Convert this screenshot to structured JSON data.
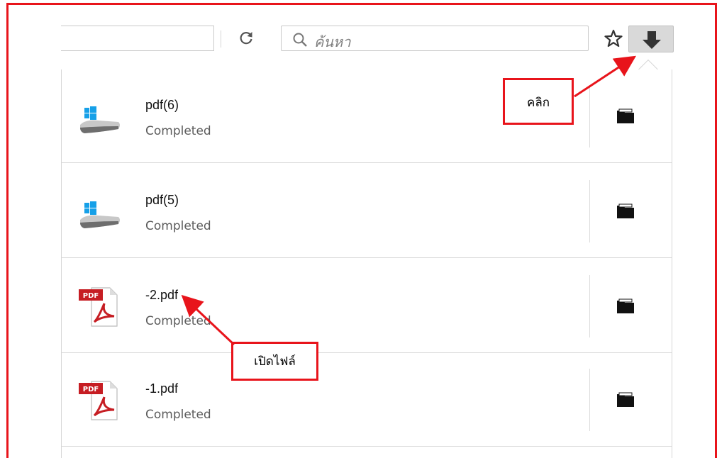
{
  "toolbar": {
    "search_placeholder": "ค้นหา",
    "icons": [
      "reload-icon",
      "search-icon",
      "star-icon",
      "reader-icon",
      "download-icon"
    ]
  },
  "downloads": [
    {
      "name": "pdf(6)",
      "status": "Completed",
      "icon": "drive-icon"
    },
    {
      "name": "pdf(5)",
      "status": "Completed",
      "icon": "drive-icon"
    },
    {
      "name": "-2.pdf",
      "status": "Completed",
      "icon": "pdf-icon"
    },
    {
      "name": "-1.pdf",
      "status": "Completed",
      "icon": "pdf-icon"
    }
  ],
  "annotations": {
    "click_label": "คลิก",
    "open_file_label": "เปิดไฟล์"
  },
  "colors": {
    "annotation": "#e8141b",
    "windows_blue": "#16a0e8",
    "pdf_red": "#c61d23"
  }
}
